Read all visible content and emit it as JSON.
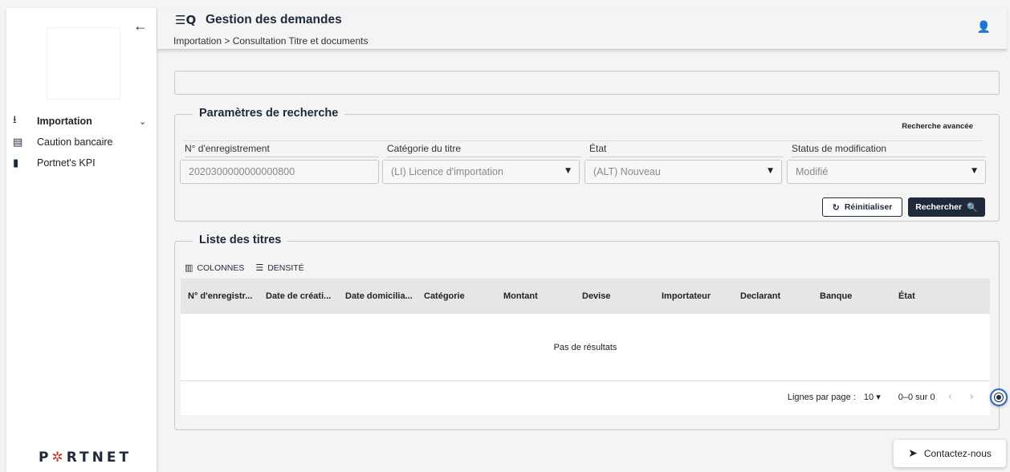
{
  "sidebar": {
    "back_icon": "←",
    "items": [
      {
        "icon": "⭳",
        "label": "Importation",
        "chevron": "⌄"
      },
      {
        "icon": "▤",
        "label": "Caution bancaire"
      },
      {
        "icon": "▮",
        "label": "Portnet's KPI"
      }
    ],
    "brand": {
      "pre": "P",
      "star": "✲",
      "post": "RTNET"
    }
  },
  "header": {
    "icon": "☰Q",
    "title": "Gestion des demandes",
    "breadcrumb": "Importation > Consultation Titre et documents",
    "user_icon": "👤"
  },
  "search": {
    "legend": "Paramètres de recherche",
    "advanced_link": "Recherche avancée",
    "fields": [
      {
        "label": "N° d'enregistrement",
        "value": "2020300000000000800"
      },
      {
        "label": "Catégorie du titre",
        "value": "(LI) Licence d'importation"
      },
      {
        "label": "État",
        "value": "(ALT) Nouveau"
      },
      {
        "label": "Status de modification",
        "value": "Modifié"
      }
    ],
    "reset_icon": "↻",
    "reset_label": "Réinitialiser",
    "search_label": "Rechercher",
    "search_icon": "🔍"
  },
  "list": {
    "legend": "Liste des titres",
    "columns_btn": "COLONNES",
    "density_btn": "DENSITÉ",
    "columns": [
      "N° d'enregistr...",
      "Date de créati...",
      "Date domicilia...",
      "Catégorie",
      "Montant",
      "Devise",
      "Importateur",
      "Declarant",
      "Banque",
      "État"
    ],
    "empty": "Pas de résultats",
    "rows_label": "Lignes par page :",
    "rows_value": "10",
    "range": "0–0 sur 0",
    "prev": "‹",
    "next": "›"
  },
  "contact": {
    "icon": "➤",
    "label": "Contactez-nous"
  },
  "colors": {
    "accent": "#1e2a3a",
    "fab_border": "#2b66c9",
    "background": "#f4f4f4"
  }
}
